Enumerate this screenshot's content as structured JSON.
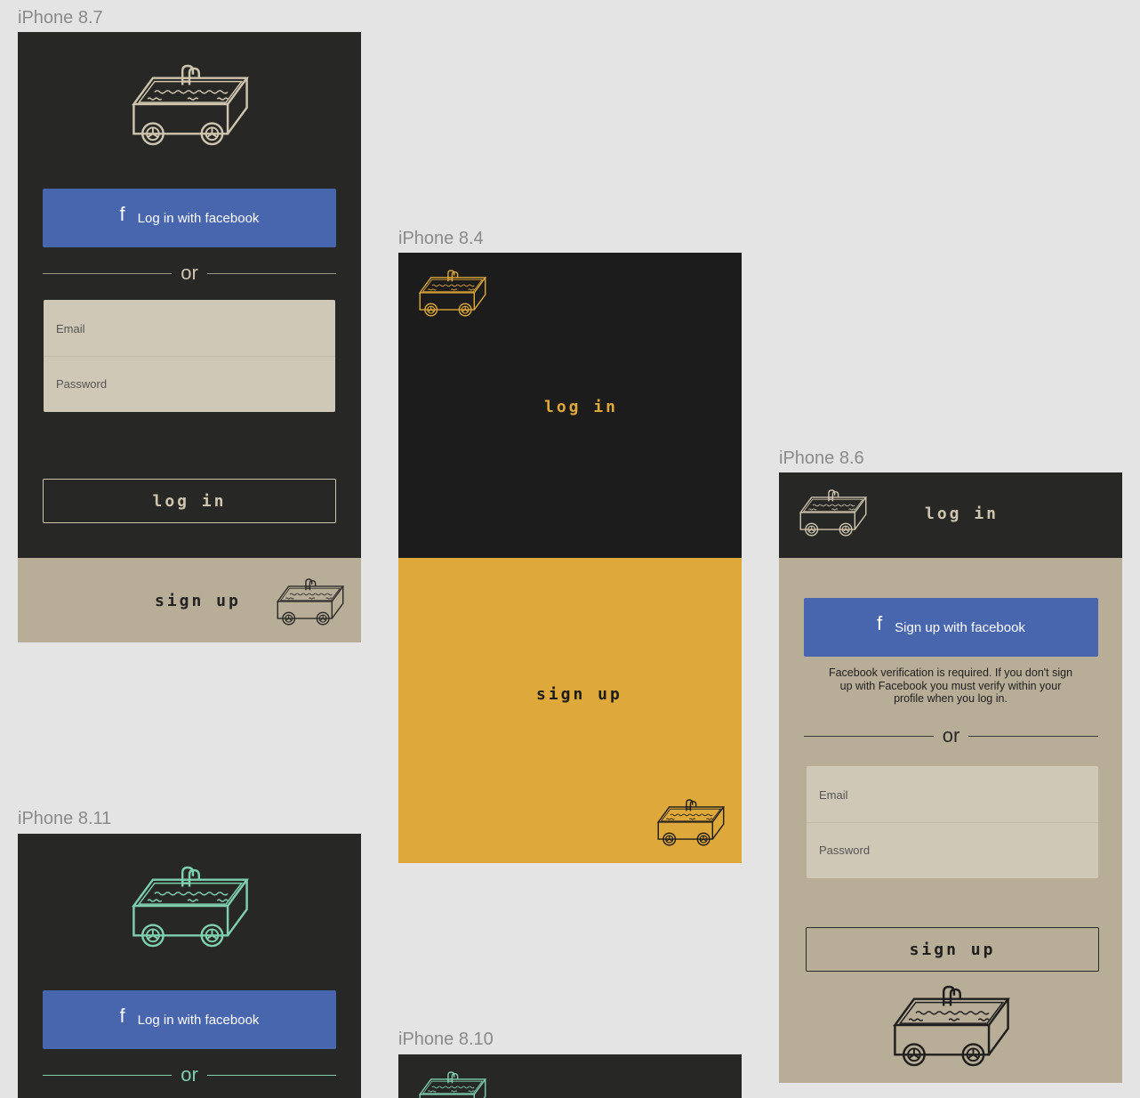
{
  "colors": {
    "dark_bg": "#272825",
    "black_bg": "#1c1c1c",
    "tan_bg": "#b8ad97",
    "form_bg": "#d0c8b6",
    "facebook_blue": "#4866ae",
    "mustard": "#dfa83a",
    "teal_accent": "#7ecfae",
    "cream_stroke": "#cfc4ad"
  },
  "artboards": {
    "a87": {
      "label": "iPhone 8.7",
      "fb_button_label": "Log in with facebook",
      "fb_icon": "f",
      "or_label": "or",
      "email_placeholder": "Email",
      "password_placeholder": "Password",
      "login_button_label": "log in",
      "signup_label": "sign up"
    },
    "a84": {
      "label": "iPhone 8.4",
      "login_label": "log in",
      "signup_label": "sign up"
    },
    "a86": {
      "label": "iPhone 8.6",
      "header_login_label": "log in",
      "fb_button_label": "Sign up with facebook",
      "fb_icon": "f",
      "fb_notice": "Facebook verification is required. If you don't sign up with Facebook you must verify within your profile when you log in.",
      "or_label": "or",
      "email_placeholder": "Email",
      "password_placeholder": "Password",
      "signup_button_label": "sign up"
    },
    "a811": {
      "label": "iPhone 8.11",
      "fb_button_label": "Log in with facebook",
      "fb_icon": "f",
      "or_label": "or"
    },
    "a810": {
      "label": "iPhone 8.10"
    }
  },
  "icons": {
    "logo": "hot-tub-cart-icon"
  }
}
